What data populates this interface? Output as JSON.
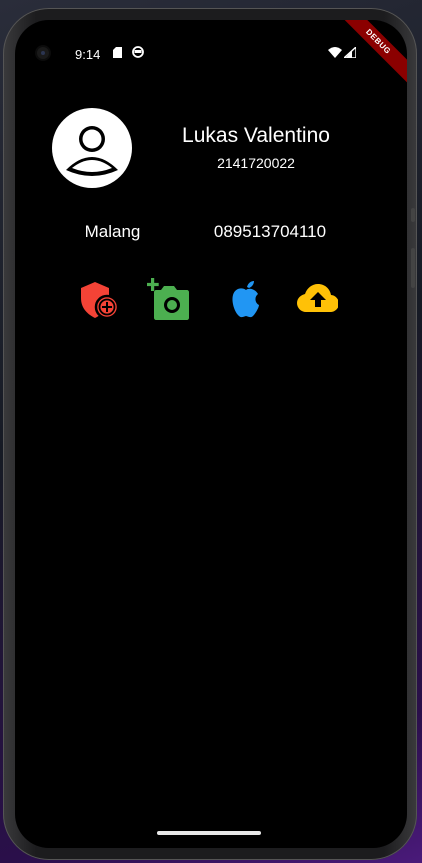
{
  "status_bar": {
    "time": "9:14",
    "debug_label": "DEBUG"
  },
  "profile": {
    "name": "Lukas Valentino",
    "id": "2141720022",
    "city": "Malang",
    "phone": "089513704110"
  },
  "actions": [
    {
      "icon": "add-moderator-icon",
      "color": "#f44336"
    },
    {
      "icon": "add-a-photo-icon",
      "color": "#4caf50"
    },
    {
      "icon": "apple-icon",
      "color": "#2196f3"
    },
    {
      "icon": "cloud-upload-icon",
      "color": "#ffc107"
    }
  ],
  "colors": {
    "screen_background": "#000000",
    "text": "#ffffff",
    "debug_banner": "#8b0000"
  }
}
